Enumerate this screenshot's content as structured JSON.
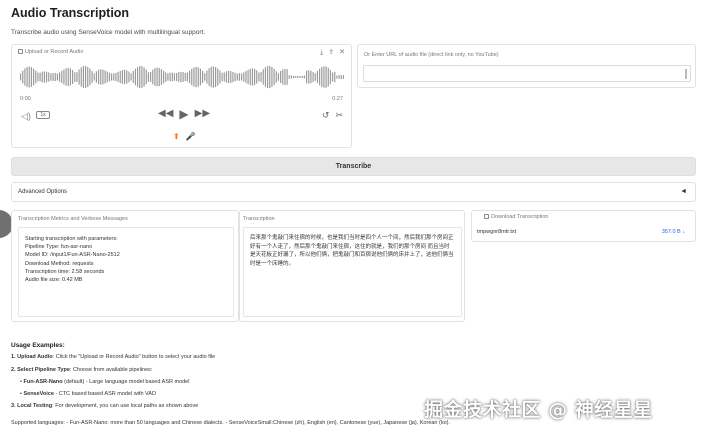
{
  "header": {
    "title": "Audio Transcription",
    "subtitle": "Transcribe audio using SenseVoice model with multilingual support."
  },
  "audio": {
    "label": "Upload or Record Audio",
    "time_start": "0:00",
    "time_end": "0:27",
    "speed": "1x",
    "wave_color": "#9a9a9a"
  },
  "url": {
    "label": "Or Enter URL of audio file (direct link only, no YouTube)",
    "value": ""
  },
  "transcribe": {
    "label": "Transcribe"
  },
  "advanced": {
    "label": "Advanced Options",
    "caret": "◄"
  },
  "metrics": {
    "label": "Transcription Metrics and Verbose Messages",
    "lines": [
      "Starting transcription with parameters:",
      "Pipeline Type: fun-asr-nano",
      "Model ID: /input1/Fun-ASR-Nano-2512",
      "Download Method: requests",
      "Transcription time: 2.58 seconds",
      "Audio file size: 0.42 MB"
    ]
  },
  "transcription": {
    "label": "Transcription",
    "text": "后来那个鬼敲门来住宿的时候，也是我们当时是四个人一个间，然后我们那个房间正好有一个人走了，然后那个鬼敲门来住宿，这住的就是，我们的那个房间 而且当时是天花板正好漏了，所以他们俩，把鬼敲门和百宿说他们俩的床并上了，这他们俩当时是一个床睡的。"
  },
  "download": {
    "label": "Download Transcription",
    "file_name": "tmpwgnr8mtr.txt",
    "file_size": "357.0 B ↓"
  },
  "usage": {
    "title": "Usage Examples:",
    "step1_bold": "1. Upload Audio",
    "step1_rest": ": Click the \"Upload or Record Audio\" button to select your audio file",
    "step2_bold": "2. Select Pipeline Type",
    "step2_rest": ": Choose from available pipelines:",
    "opt1_bold": "Fun-ASR-Nano",
    "opt1_rest": " (default) - Large language model based ASR model",
    "opt2_bold": "SenseVoice",
    "opt2_rest": " - CTC based based ASR model with VAD",
    "step3_bold": "3. Local Testing",
    "step3_rest": ": For development, you can use local paths as shown above",
    "languages": "Supported languages: - Fun-ASR-Nano: more than 50 languages and Chinese dialects. - SenseVoiceSmall:Chinese (zh), English (en), Cantonese (yue), Japanese (ja), Korean (ko)."
  },
  "watermark": {
    "text": "掘金技术社区 @ 神经星星"
  }
}
